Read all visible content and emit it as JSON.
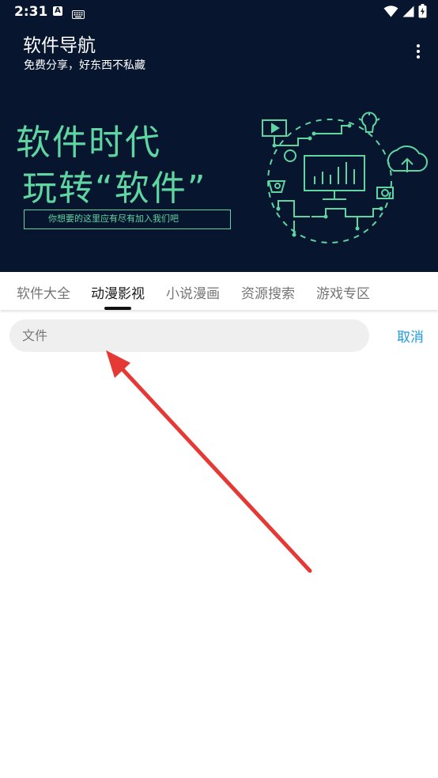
{
  "status_bar": {
    "time": "2:31",
    "a_badge": "A",
    "left_icons": [
      "a-badge-icon",
      "keyboard-icon"
    ],
    "right_icons": [
      "wifi-icon",
      "cell-signal-icon",
      "battery-icon"
    ]
  },
  "app_bar": {
    "title": "软件导航",
    "subtitle": "免费分享，好东西不私藏",
    "menu_icon": "more-vert-icon"
  },
  "banner": {
    "line1": "软件时代",
    "line2": "玩转“软件”",
    "tagline": "你想要的这里应有尽有加入我们吧",
    "accent_color": "#5fd6a1",
    "background_color": "#07152f"
  },
  "tabs": {
    "items": [
      "软件大全",
      "动漫影视",
      "小说漫画",
      "资源搜索",
      "游戏专区"
    ],
    "active_index": 1
  },
  "search": {
    "value": "",
    "placeholder": "文件",
    "cancel_label": "取消"
  },
  "colors": {
    "header_background": "#07152f",
    "link_blue": "#1e9be0",
    "annotation_red": "#e53935"
  }
}
